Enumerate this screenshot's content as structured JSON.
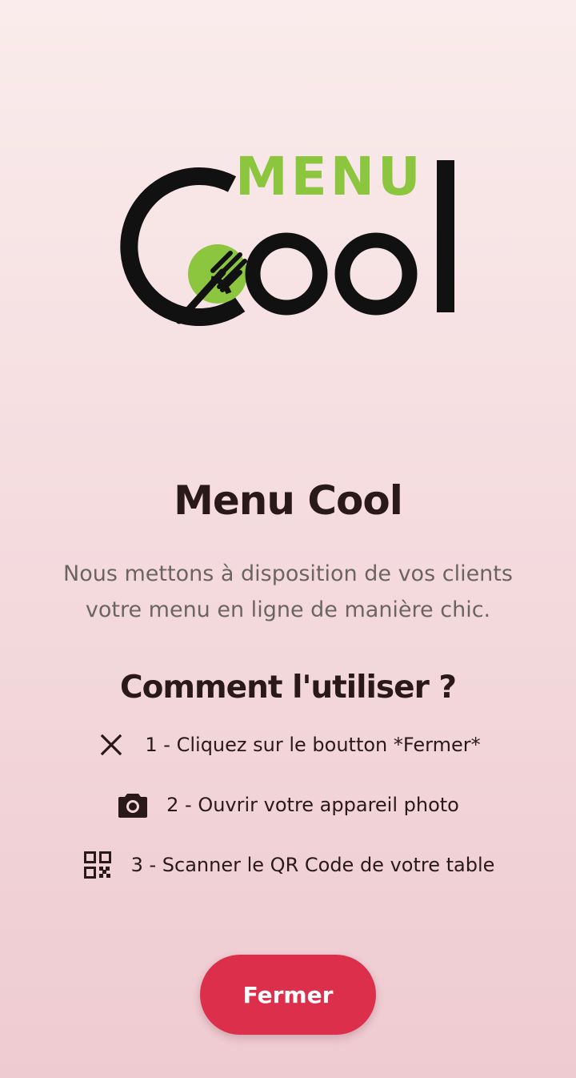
{
  "logo": {
    "word_top": "MENU",
    "word_bottom": "Cool",
    "accent_color": "#8cc63f",
    "dark_color": "#111111",
    "icon": "fork-icon"
  },
  "title": "Menu Cool",
  "description": "Nous mettons à disposition de vos clients votre menu en ligne de manière chic.",
  "how_to": {
    "title": "Comment l'utiliser ?",
    "steps": [
      {
        "icon": "close-icon",
        "label": "1 - Cliquez sur le boutton *Fermer*"
      },
      {
        "icon": "camera-icon",
        "label": "2 - Ouvrir votre appareil photo"
      },
      {
        "icon": "qr-code-icon",
        "label": "3 - Scanner le QR Code de votre table"
      }
    ]
  },
  "close_button": {
    "label": "Fermer",
    "color": "#dc2f4c"
  }
}
